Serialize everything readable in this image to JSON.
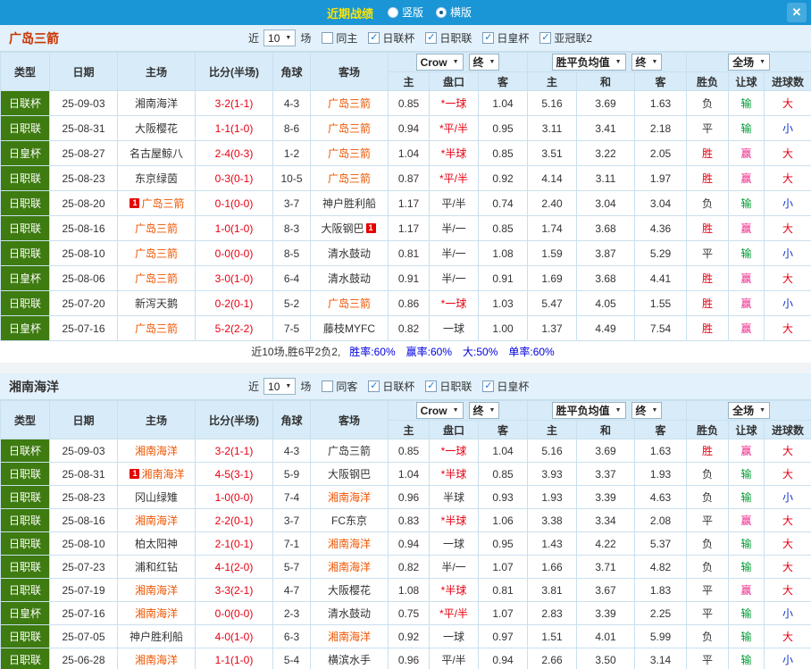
{
  "topbar": {
    "title": "近期战绩",
    "radios": [
      {
        "label": "竖版",
        "selected": false
      },
      {
        "label": "横版",
        "selected": true
      }
    ],
    "close": "✕"
  },
  "columns": {
    "left": [
      "类型",
      "日期",
      "主场",
      "比分(半场)",
      "角球",
      "客场"
    ],
    "asian_group": {
      "select1": "Crow",
      "select2": "终",
      "cols": [
        "主",
        "盘口",
        "客"
      ]
    },
    "europe_group": {
      "select1": "胜平负均值",
      "select2": "终",
      "cols": [
        "主",
        "和",
        "客"
      ]
    },
    "result_group": {
      "select": "全场",
      "cols": [
        "胜负",
        "让球",
        "进球数"
      ]
    }
  },
  "sections": [
    {
      "team": "广岛三箭",
      "team_color": "#cc3300",
      "filter": {
        "recent_label": "近",
        "count": "10",
        "unit": "场",
        "checkboxes": [
          {
            "label": "同主",
            "checked": false
          },
          {
            "label": "日联杯",
            "checked": true
          },
          {
            "label": "日职联",
            "checked": true
          },
          {
            "label": "日皇杯",
            "checked": true
          },
          {
            "label": "亚冠联2",
            "checked": true
          }
        ]
      },
      "rows": [
        {
          "type": "日联杯",
          "date": "25-09-03",
          "home": {
            "name": "湘南海洋"
          },
          "score": "3-2(1-1)",
          "corner": "4-3",
          "away": {
            "name": "广岛三箭"
          },
          "asian": [
            "0.85",
            "*一球",
            "1.04"
          ],
          "europe": [
            "5.16",
            "3.69",
            "1.63"
          ],
          "result": "负",
          "handicap": "输",
          "goals": "大"
        },
        {
          "type": "日职联",
          "date": "25-08-31",
          "home": {
            "name": "大阪樱花"
          },
          "score": "1-1(1-0)",
          "corner": "8-6",
          "away": {
            "name": "广岛三箭"
          },
          "asian": [
            "0.94",
            "*平/半",
            "0.95"
          ],
          "europe": [
            "3.11",
            "3.41",
            "2.18"
          ],
          "result": "平",
          "handicap": "输",
          "goals": "小"
        },
        {
          "type": "日皇杯",
          "date": "25-08-27",
          "home": {
            "name": "名古屋鲸八"
          },
          "score": "2-4(0-3)",
          "corner": "1-2",
          "away": {
            "name": "广岛三箭"
          },
          "asian": [
            "1.04",
            "*半球",
            "0.85"
          ],
          "europe": [
            "3.51",
            "3.22",
            "2.05"
          ],
          "result": "胜",
          "handicap": "赢",
          "goals": "大"
        },
        {
          "type": "日职联",
          "date": "25-08-23",
          "home": {
            "name": "东京绿茵"
          },
          "score": "0-3(0-1)",
          "corner": "10-5",
          "away": {
            "name": "广岛三箭"
          },
          "asian": [
            "0.87",
            "*平/半",
            "0.92"
          ],
          "europe": [
            "4.14",
            "3.11",
            "1.97"
          ],
          "result": "胜",
          "handicap": "赢",
          "goals": "大"
        },
        {
          "type": "日职联",
          "date": "25-08-20",
          "home": {
            "name": "广岛三箭",
            "badge": "1",
            "side": "left"
          },
          "score": "0-1(0-0)",
          "corner": "3-7",
          "away": {
            "name": "神户胜利船"
          },
          "asian": [
            "1.17",
            "平/半",
            "0.74"
          ],
          "europe": [
            "2.40",
            "3.04",
            "3.04"
          ],
          "result": "负",
          "handicap": "输",
          "goals": "小"
        },
        {
          "type": "日职联",
          "date": "25-08-16",
          "home": {
            "name": "广岛三箭"
          },
          "score": "1-0(1-0)",
          "corner": "8-3",
          "away": {
            "name": "大阪钢巴",
            "badge": "1",
            "side": "right"
          },
          "asian": [
            "1.17",
            "半/一",
            "0.85"
          ],
          "europe": [
            "1.74",
            "3.68",
            "4.36"
          ],
          "result": "胜",
          "handicap": "赢",
          "goals": "大"
        },
        {
          "type": "日职联",
          "date": "25-08-10",
          "home": {
            "name": "广岛三箭"
          },
          "score": "0-0(0-0)",
          "corner": "8-5",
          "away": {
            "name": "清水鼓动"
          },
          "asian": [
            "0.81",
            "半/一",
            "1.08"
          ],
          "europe": [
            "1.59",
            "3.87",
            "5.29"
          ],
          "result": "平",
          "handicap": "输",
          "goals": "小"
        },
        {
          "type": "日皇杯",
          "date": "25-08-06",
          "home": {
            "name": "广岛三箭"
          },
          "score": "3-0(1-0)",
          "corner": "6-4",
          "away": {
            "name": "清水鼓动"
          },
          "asian": [
            "0.91",
            "半/一",
            "0.91"
          ],
          "europe": [
            "1.69",
            "3.68",
            "4.41"
          ],
          "result": "胜",
          "handicap": "赢",
          "goals": "大"
        },
        {
          "type": "日职联",
          "date": "25-07-20",
          "home": {
            "name": "新泻天鹅"
          },
          "score": "0-2(0-1)",
          "corner": "5-2",
          "away": {
            "name": "广岛三箭"
          },
          "asian": [
            "0.86",
            "*一球",
            "1.03"
          ],
          "europe": [
            "5.47",
            "4.05",
            "1.55"
          ],
          "result": "胜",
          "handicap": "赢",
          "goals": "小"
        },
        {
          "type": "日皇杯",
          "date": "25-07-16",
          "home": {
            "name": "广岛三箭"
          },
          "score": "5-2(2-2)",
          "corner": "7-5",
          "away": {
            "name": "藤枝MYFC"
          },
          "asian": [
            "0.82",
            "一球",
            "1.00"
          ],
          "europe": [
            "1.37",
            "4.49",
            "7.54"
          ],
          "result": "胜",
          "handicap": "赢",
          "goals": "大"
        }
      ],
      "summary": {
        "prefix": "近10场,胜6平2负2,",
        "stats": [
          "胜率:60%",
          "赢率:60%",
          "大:50%",
          "单率:60%"
        ]
      }
    },
    {
      "team": "湘南海洋",
      "team_color": "#333333",
      "filter": {
        "recent_label": "近",
        "count": "10",
        "unit": "场",
        "checkboxes": [
          {
            "label": "同客",
            "checked": false
          },
          {
            "label": "日联杯",
            "checked": true
          },
          {
            "label": "日职联",
            "checked": true
          },
          {
            "label": "日皇杯",
            "checked": true
          }
        ]
      },
      "rows": [
        {
          "type": "日联杯",
          "date": "25-09-03",
          "home": {
            "name": "湘南海洋"
          },
          "score": "3-2(1-1)",
          "corner": "4-3",
          "away": {
            "name": "广岛三箭"
          },
          "asian": [
            "0.85",
            "*一球",
            "1.04"
          ],
          "europe": [
            "5.16",
            "3.69",
            "1.63"
          ],
          "result": "胜",
          "handicap": "赢",
          "goals": "大"
        },
        {
          "type": "日职联",
          "date": "25-08-31",
          "home": {
            "name": "湘南海洋",
            "badge": "1",
            "side": "left"
          },
          "score": "4-5(3-1)",
          "corner": "5-9",
          "away": {
            "name": "大阪钢巴"
          },
          "asian": [
            "1.04",
            "*半球",
            "0.85"
          ],
          "europe": [
            "3.93",
            "3.37",
            "1.93"
          ],
          "result": "负",
          "handicap": "输",
          "goals": "大"
        },
        {
          "type": "日职联",
          "date": "25-08-23",
          "home": {
            "name": "冈山绿雉"
          },
          "score": "1-0(0-0)",
          "corner": "7-4",
          "away": {
            "name": "湘南海洋"
          },
          "asian": [
            "0.96",
            "半球",
            "0.93"
          ],
          "europe": [
            "1.93",
            "3.39",
            "4.63"
          ],
          "result": "负",
          "handicap": "输",
          "goals": "小"
        },
        {
          "type": "日职联",
          "date": "25-08-16",
          "home": {
            "name": "湘南海洋"
          },
          "score": "2-2(0-1)",
          "corner": "3-7",
          "away": {
            "name": "FC东京"
          },
          "asian": [
            "0.83",
            "*半球",
            "1.06"
          ],
          "europe": [
            "3.38",
            "3.34",
            "2.08"
          ],
          "result": "平",
          "handicap": "赢",
          "goals": "大"
        },
        {
          "type": "日职联",
          "date": "25-08-10",
          "home": {
            "name": "柏太阳神"
          },
          "score": "2-1(0-1)",
          "corner": "7-1",
          "away": {
            "name": "湘南海洋"
          },
          "asian": [
            "0.94",
            "一球",
            "0.95"
          ],
          "europe": [
            "1.43",
            "4.22",
            "5.37"
          ],
          "result": "负",
          "handicap": "输",
          "goals": "大"
        },
        {
          "type": "日职联",
          "date": "25-07-23",
          "home": {
            "name": "浦和红钻"
          },
          "score": "4-1(2-0)",
          "corner": "5-7",
          "away": {
            "name": "湘南海洋"
          },
          "asian": [
            "0.82",
            "半/一",
            "1.07"
          ],
          "europe": [
            "1.66",
            "3.71",
            "4.82"
          ],
          "result": "负",
          "handicap": "输",
          "goals": "大"
        },
        {
          "type": "日职联",
          "date": "25-07-19",
          "home": {
            "name": "湘南海洋"
          },
          "score": "3-3(2-1)",
          "corner": "4-7",
          "away": {
            "name": "大阪樱花"
          },
          "asian": [
            "1.08",
            "*半球",
            "0.81"
          ],
          "europe": [
            "3.81",
            "3.67",
            "1.83"
          ],
          "result": "平",
          "handicap": "赢",
          "goals": "大"
        },
        {
          "type": "日皇杯",
          "date": "25-07-16",
          "home": {
            "name": "湘南海洋"
          },
          "score": "0-0(0-0)",
          "corner": "2-3",
          "away": {
            "name": "清水鼓动"
          },
          "asian": [
            "0.75",
            "*平/半",
            "1.07"
          ],
          "europe": [
            "2.83",
            "3.39",
            "2.25"
          ],
          "result": "平",
          "handicap": "输",
          "goals": "小"
        },
        {
          "type": "日职联",
          "date": "25-07-05",
          "home": {
            "name": "神户胜利船"
          },
          "score": "4-0(1-0)",
          "corner": "6-3",
          "away": {
            "name": "湘南海洋"
          },
          "asian": [
            "0.92",
            "一球",
            "0.97"
          ],
          "europe": [
            "1.51",
            "4.01",
            "5.99"
          ],
          "result": "负",
          "handicap": "输",
          "goals": "大"
        },
        {
          "type": "日职联",
          "date": "25-06-28",
          "home": {
            "name": "湘南海洋"
          },
          "score": "1-1(1-0)",
          "corner": "5-4",
          "away": {
            "name": "横滨水手"
          },
          "asian": [
            "0.96",
            "平/半",
            "0.94"
          ],
          "europe": [
            "2.66",
            "3.50",
            "3.14"
          ],
          "result": "平",
          "handicap": "输",
          "goals": "小"
        }
      ]
    }
  ]
}
